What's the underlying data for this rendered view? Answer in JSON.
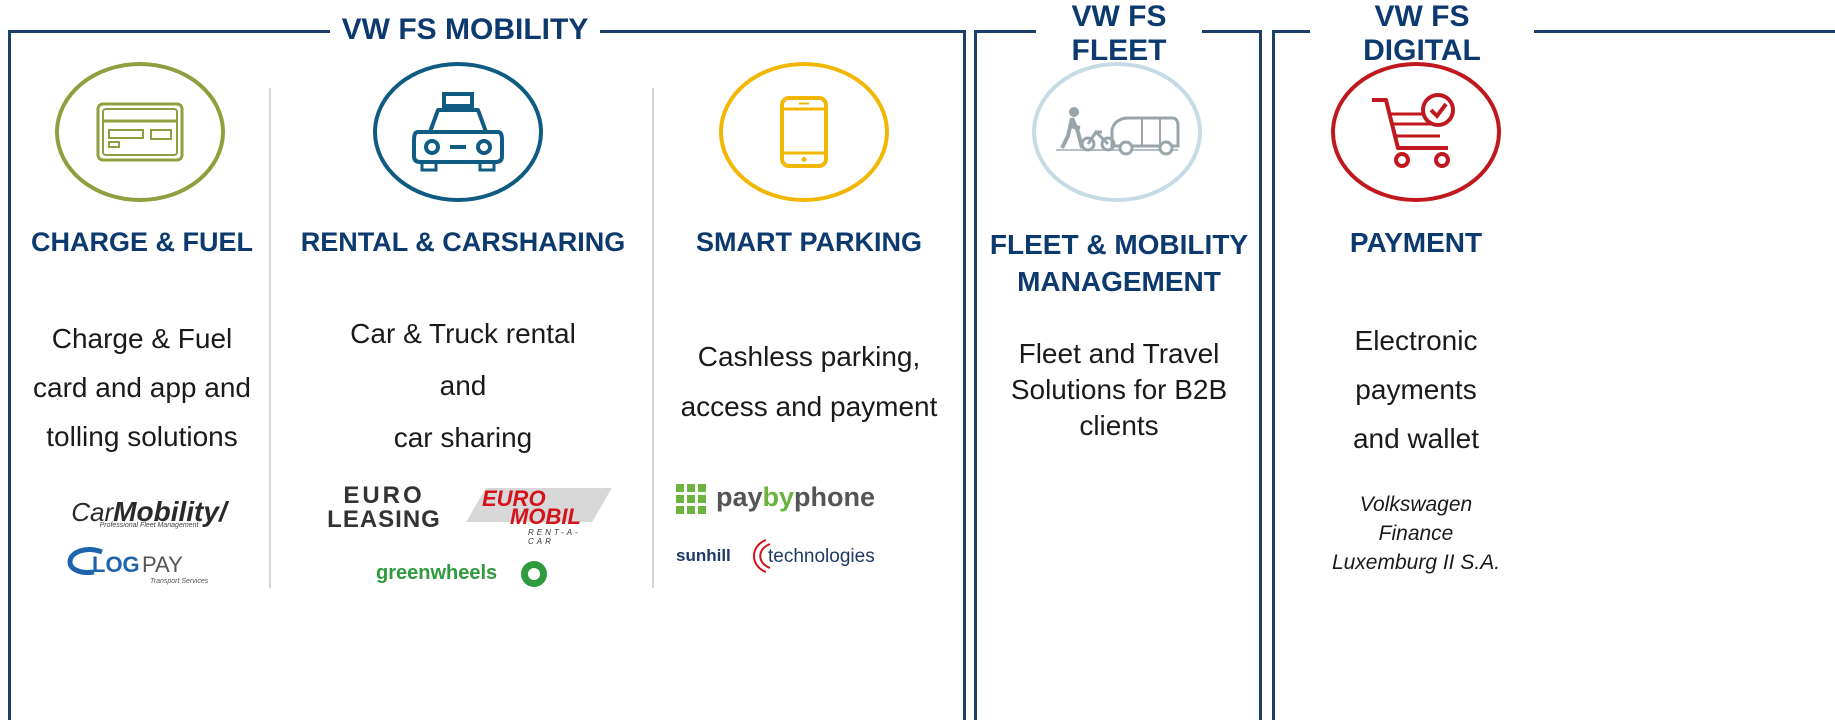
{
  "sections": {
    "mobility": {
      "title": "VW FS MOBILITY"
    },
    "fleet": {
      "title_line1": "VW FS",
      "title_line2": "FLEET"
    },
    "digital": {
      "title_line1": "VW FS",
      "title_line2": "DIGITAL"
    }
  },
  "columns": {
    "charge": {
      "heading": "CHARGE & FUEL",
      "desc": [
        "Charge & Fuel",
        "card and app and",
        "tolling solutions"
      ],
      "icon": "credit-card-icon",
      "color": "#8f9f3f",
      "logos": {
        "carmobility_a": "Car",
        "carmobility_b": "Mobility",
        "carmobility_tag": "Professional Fleet Management",
        "logpay_a": "LOG",
        "logpay_b": "PAY",
        "logpay_tag": "Transport Services"
      }
    },
    "rental": {
      "heading": "RENTAL & CARSHARING",
      "desc": [
        "Car & Truck rental",
        "and",
        "car sharing"
      ],
      "icon": "taxi-icon",
      "color": "#0f5b82",
      "logos": {
        "euro1": "EURO",
        "euro2": "LEASING",
        "euromobil1": "EURO",
        "euromobil2": "MOBIL",
        "euromobil_tag": "RENT-A-CAR",
        "greenwheels": "greenwheels"
      }
    },
    "parking": {
      "heading": "SMART PARKING",
      "desc": [
        "Cashless parking,",
        "access and payment"
      ],
      "icon": "smartphone-icon",
      "color": "#f2b705",
      "logos": {
        "paybyphone_a": "pay",
        "paybyphone_b": "by",
        "paybyphone_c": "phone",
        "sunhill": "sunhill",
        "technologies": "technologies"
      }
    },
    "fleet": {
      "heading": [
        "FLEET & MOBILITY",
        "MANAGEMENT"
      ],
      "desc": [
        "Fleet and Travel",
        "Solutions for B2B",
        "clients"
      ],
      "icon": "fleet-vehicles-icon",
      "color": "#c7dbe5"
    },
    "payment": {
      "heading": "PAYMENT",
      "desc": [
        "Electronic",
        "payments",
        "and wallet"
      ],
      "icon": "shopping-cart-check-icon",
      "color": "#c0181f",
      "note": [
        "Volkswagen",
        "Finance",
        "Luxemburg II S.A."
      ]
    }
  }
}
